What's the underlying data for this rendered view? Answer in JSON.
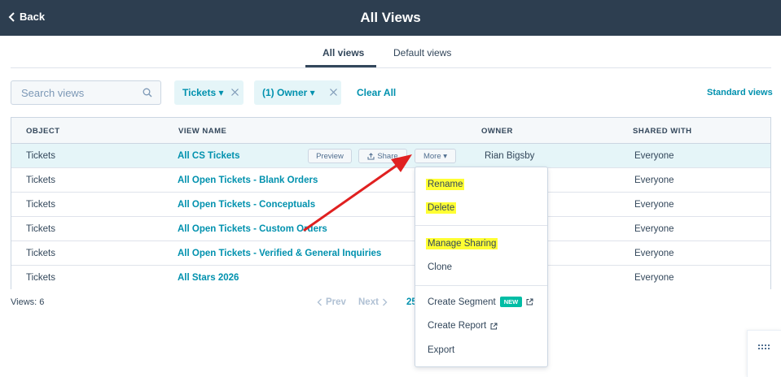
{
  "header": {
    "back_label": "Back",
    "title": "All Views"
  },
  "tabs": [
    {
      "label": "All views",
      "active": true
    },
    {
      "label": "Default views",
      "active": false
    }
  ],
  "toolbar": {
    "search_placeholder": "Search views",
    "filters": [
      {
        "label": "Tickets ▾"
      },
      {
        "label": "(1) Owner ▾"
      }
    ],
    "clear_all": "Clear All",
    "standard_views": "Standard views"
  },
  "table": {
    "columns": [
      "OBJECT",
      "VIEW NAME",
      "OWNER",
      "SHARED WITH"
    ],
    "rows": [
      {
        "object": "Tickets",
        "view_name": "All CS Tickets",
        "owner": "Rian Bigsby",
        "shared_with": "Everyone"
      },
      {
        "object": "Tickets",
        "view_name": "All Open Tickets - Blank Orders",
        "owner": "",
        "shared_with": "Everyone"
      },
      {
        "object": "Tickets",
        "view_name": "All Open Tickets - Conceptuals",
        "owner": "",
        "shared_with": "Everyone"
      },
      {
        "object": "Tickets",
        "view_name": "All Open Tickets - Custom Orders",
        "owner": "",
        "shared_with": "Everyone"
      },
      {
        "object": "Tickets",
        "view_name": "All Open Tickets - Verified & General Inquiries",
        "owner": "",
        "shared_with": "Everyone"
      },
      {
        "object": "Tickets",
        "view_name": "All Stars 2026",
        "owner": "",
        "shared_with": "Everyone"
      }
    ],
    "row_actions": {
      "preview": "Preview",
      "share": "Share",
      "more": "More ▾"
    }
  },
  "footer": {
    "views_count": "Views: 6",
    "prev": "Prev",
    "next": "Next",
    "per_page": "25"
  },
  "more_menu": {
    "rename": "Rename",
    "delete": "Delete",
    "manage_sharing": "Manage Sharing",
    "clone": "Clone",
    "create_segment": "Create Segment",
    "new_badge": "NEW",
    "create_report": "Create Report",
    "export": "Export"
  },
  "colors": {
    "header_bg": "#2d3e50",
    "link": "#0091ae",
    "highlight": "#ffff33",
    "annotation_arrow": "#e02020",
    "new_badge": "#00bda5"
  },
  "icons": [
    "chevron-left-icon",
    "search-icon",
    "close-icon",
    "share-icon",
    "external-link-icon",
    "grid-icon"
  ]
}
